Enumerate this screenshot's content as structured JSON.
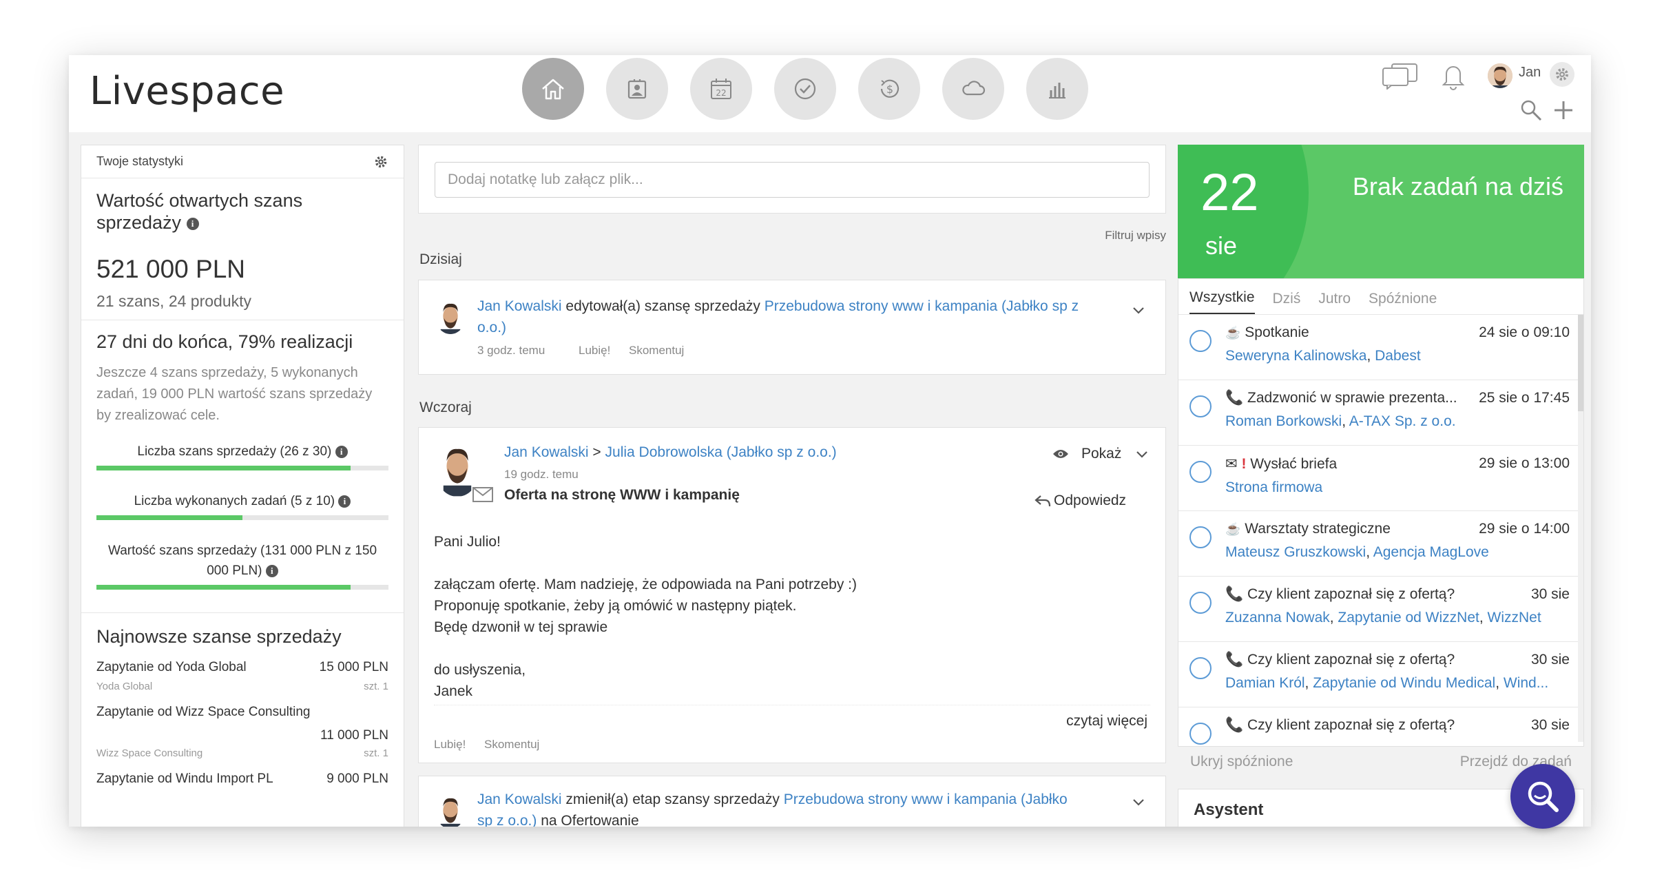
{
  "header": {
    "logo": "Livespace",
    "user_name": "Jan",
    "nav": [
      {
        "name": "home-icon",
        "active": true
      },
      {
        "name": "contacts-icon",
        "active": false
      },
      {
        "name": "calendar-icon",
        "label": "22",
        "active": false
      },
      {
        "name": "tasks-check-icon",
        "active": false
      },
      {
        "name": "deals-dollar-icon",
        "active": false
      },
      {
        "name": "cloud-icon",
        "active": false
      },
      {
        "name": "reports-chart-icon",
        "active": false
      }
    ]
  },
  "stats": {
    "header": "Twoje statystyki",
    "open_value_title": "Wartość otwartych szans sprzedaży",
    "open_value_amount": "521 000 PLN",
    "open_value_sub": "21 szans,  24 produkty",
    "progress_title": "27 dni do końca, 79% realizacji",
    "progress_desc": "Jeszcze 4 szans sprzedaży, 5 wykonanych zadań, 19 000 PLN wartość szans sprzedaży by zrealizować cele.",
    "bars": [
      {
        "label": "Liczba szans sprzedaży (26 z 30)",
        "fraction": 0.87
      },
      {
        "label": "Liczba wykonanych zadań (5 z 10)",
        "fraction": 0.5
      },
      {
        "label": "Wartość szans sprzedaży (131 000 PLN z 150 000 PLN)",
        "fraction": 0.87
      }
    ],
    "recent_title": "Najnowsze szanse sprzedaży",
    "deals": [
      {
        "name": "Zapytanie od Yoda Global",
        "amount": "15 000 PLN",
        "company": "Yoda Global",
        "qty": "szt. 1"
      },
      {
        "name": "Zapytanie od Wizz Space Consulting",
        "amount": "11 000 PLN",
        "company": "Wizz Space Consulting",
        "qty": "szt. 1"
      },
      {
        "name": "Zapytanie od Windu Import PL",
        "amount": "9 000 PLN"
      }
    ]
  },
  "feed": {
    "note_placeholder": "Dodaj notatkę lub załącz plik...",
    "filter_label": "Filtruj wpisy",
    "today_label": "Dzisiaj",
    "yesterday_label": "Wczoraj",
    "item1": {
      "author": "Jan Kowalski",
      "action": "edytował(a) szansę sprzedaży",
      "target_line1": "Przebudowa strony www i kampania (Jabłko sp z",
      "target_line2": "o.o.)",
      "time": "3 godz. temu",
      "like": "Lubię!",
      "comment": "Skomentuj"
    },
    "email": {
      "author": "Jan Kowalski",
      "arrow": ">",
      "recipient": "Julia Dobrowolska (Jabłko sp z o.o.)",
      "time": "19 godz. temu",
      "subject": "Oferta na stronę WWW i kampanię",
      "show_label": "Pokaż",
      "reply_label": "Odpowiedz",
      "body": [
        "Pani Julio!",
        "",
        "załączam ofertę. Mam nadzieję, że odpowiada na Pani potrzeby :)",
        "Proponuję spotkanie, żeby ją omówić w następny piątek.",
        "Będę dzwonił w tej sprawie",
        "",
        "do usłyszenia,",
        "Janek"
      ],
      "read_more": "czytaj więcej",
      "like": "Lubię!",
      "comment": "Skomentuj"
    },
    "item3": {
      "author": "Jan Kowalski",
      "action": "zmienił(a) etap szansy sprzedaży",
      "target_line1": "Przebudowa strony www i kampania (Jabłko",
      "target_line2": "sp z o.o.)",
      "suffix": "na Ofertowanie"
    }
  },
  "calendar": {
    "day": "22",
    "month": "sie",
    "no_tasks": "Brak zadań na dziś",
    "tabs": [
      "Wszystkie",
      "Dziś",
      "Jutro",
      "Spóźnione"
    ],
    "tasks": [
      {
        "icon": "coffee-icon",
        "title": "Spotkanie",
        "date": "24 sie o 09:10",
        "links": [
          "Seweryna Kalinowska",
          "Dabest"
        ]
      },
      {
        "icon": "phone-icon",
        "title": "Zadzwonić w sprawie prezenta...",
        "date": "25 sie o 17:45",
        "links": [
          "Roman Borkowski",
          "A-TAX Sp. z o.o."
        ]
      },
      {
        "icon": "mail-icon",
        "urgent": "!",
        "title": "Wysłać briefa",
        "date": "29 sie o 13:00",
        "links": [
          "Strona firmowa"
        ]
      },
      {
        "icon": "coffee-icon",
        "title": "Warsztaty strategiczne",
        "date": "29 sie o 14:00",
        "links": [
          "Mateusz Gruszkowski",
          "Agencja MagLove"
        ]
      },
      {
        "icon": "phone-icon",
        "title": "Czy klient zapoznał się z ofertą?",
        "date": "30 sie",
        "links": [
          "Zuzanna Nowak",
          "Zapytanie od WizzNet",
          "WizzNet"
        ]
      },
      {
        "icon": "phone-icon",
        "title": "Czy klient zapoznał się z ofertą?",
        "date": "30 sie",
        "links": [
          "Damian Król",
          "Zapytanie od Windu Medical",
          "Wind..."
        ]
      },
      {
        "icon": "phone-icon",
        "title": "Czy klient zapoznał się z ofertą?",
        "date": "30 sie",
        "links": []
      }
    ],
    "hide_late": "Ukryj spóźnione",
    "go_to_tasks": "Przejdź do zadań",
    "assistant": "Asystent"
  },
  "colors": {
    "accent_green": "#5bc866",
    "link_blue": "#3d82c4",
    "fab": "#3f37a3"
  }
}
